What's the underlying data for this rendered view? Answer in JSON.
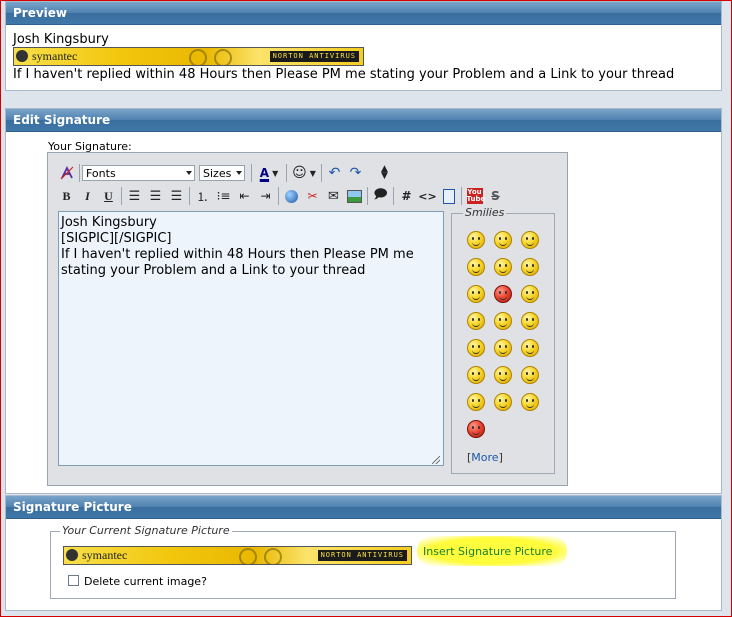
{
  "preview": {
    "header": "Preview",
    "name": "Josh Kingsbury",
    "message": "If I haven't replied within 48 Hours then Please PM me stating your Problem and a Link to your thread"
  },
  "banner": {
    "brand": "symantec",
    "product": "NORTON ANTIVIRUS"
  },
  "edit": {
    "header": "Edit Signature",
    "label": "Your Signature:",
    "fonts_value": "Fonts",
    "sizes_value": "Sizes",
    "textarea_value": "Josh Kingsbury\n[SIGPIC][/SIGPIC]\nIf I haven't replied within 48 Hours then Please PM me\nstating your Problem and a Link to your thread",
    "smilies_title": "Smilies",
    "more_link": "More",
    "toolbar_glyphs": {
      "bold": "B",
      "italic": "I",
      "underline": "U",
      "hash": "#",
      "code": "<>",
      "youtube": "You Tube",
      "strike": "S",
      "text_color": "A"
    }
  },
  "sigpic": {
    "header": "Signature Picture",
    "legend": "Your Current Signature Picture",
    "insert_link": "Insert Signature Picture",
    "delete_label": "Delete current image?"
  },
  "colors": {
    "header_blue": "#3f77a9",
    "highlight_yellow": "#ffff40",
    "link_green": "#1a7f2a"
  }
}
